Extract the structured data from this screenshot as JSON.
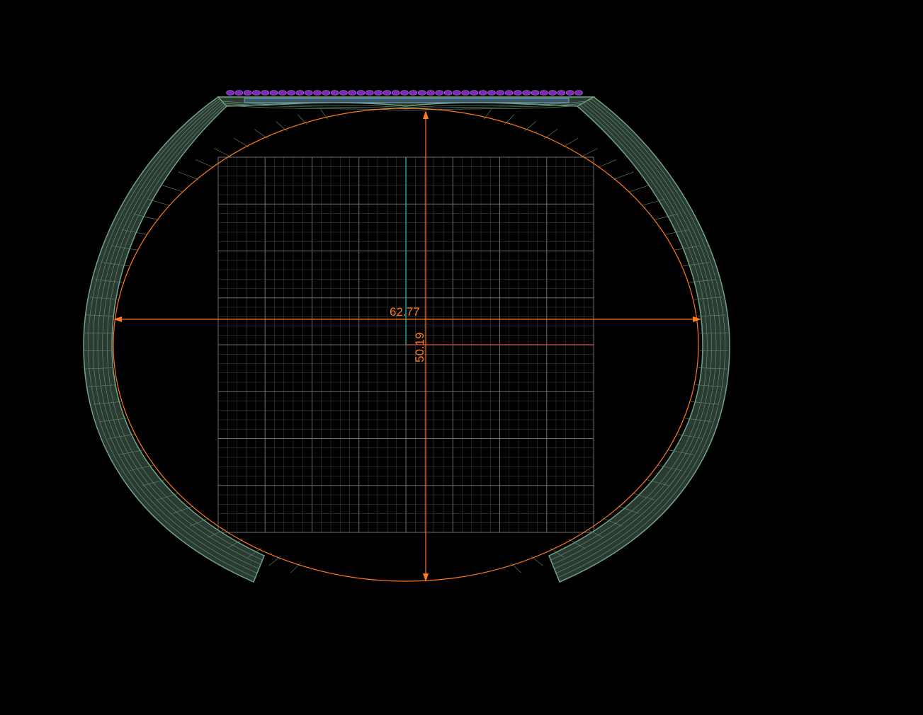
{
  "viewport": {
    "background": "#000000"
  },
  "dimensions": {
    "width_label": "62.77",
    "height_label": "50.19",
    "color": "#ff7a1a"
  },
  "colors": {
    "band_fill": "#2c3b31",
    "band_wire": "#5f8c72",
    "band_edge": "#6fa386",
    "grid": "#7a7a7a",
    "gems": "#8a2fc4",
    "channel": "#7fa6c8",
    "axis_y": "#1fa69a",
    "axis_x": "#b24a3a"
  },
  "icons": {
    "gems": "gem-row-icon"
  }
}
